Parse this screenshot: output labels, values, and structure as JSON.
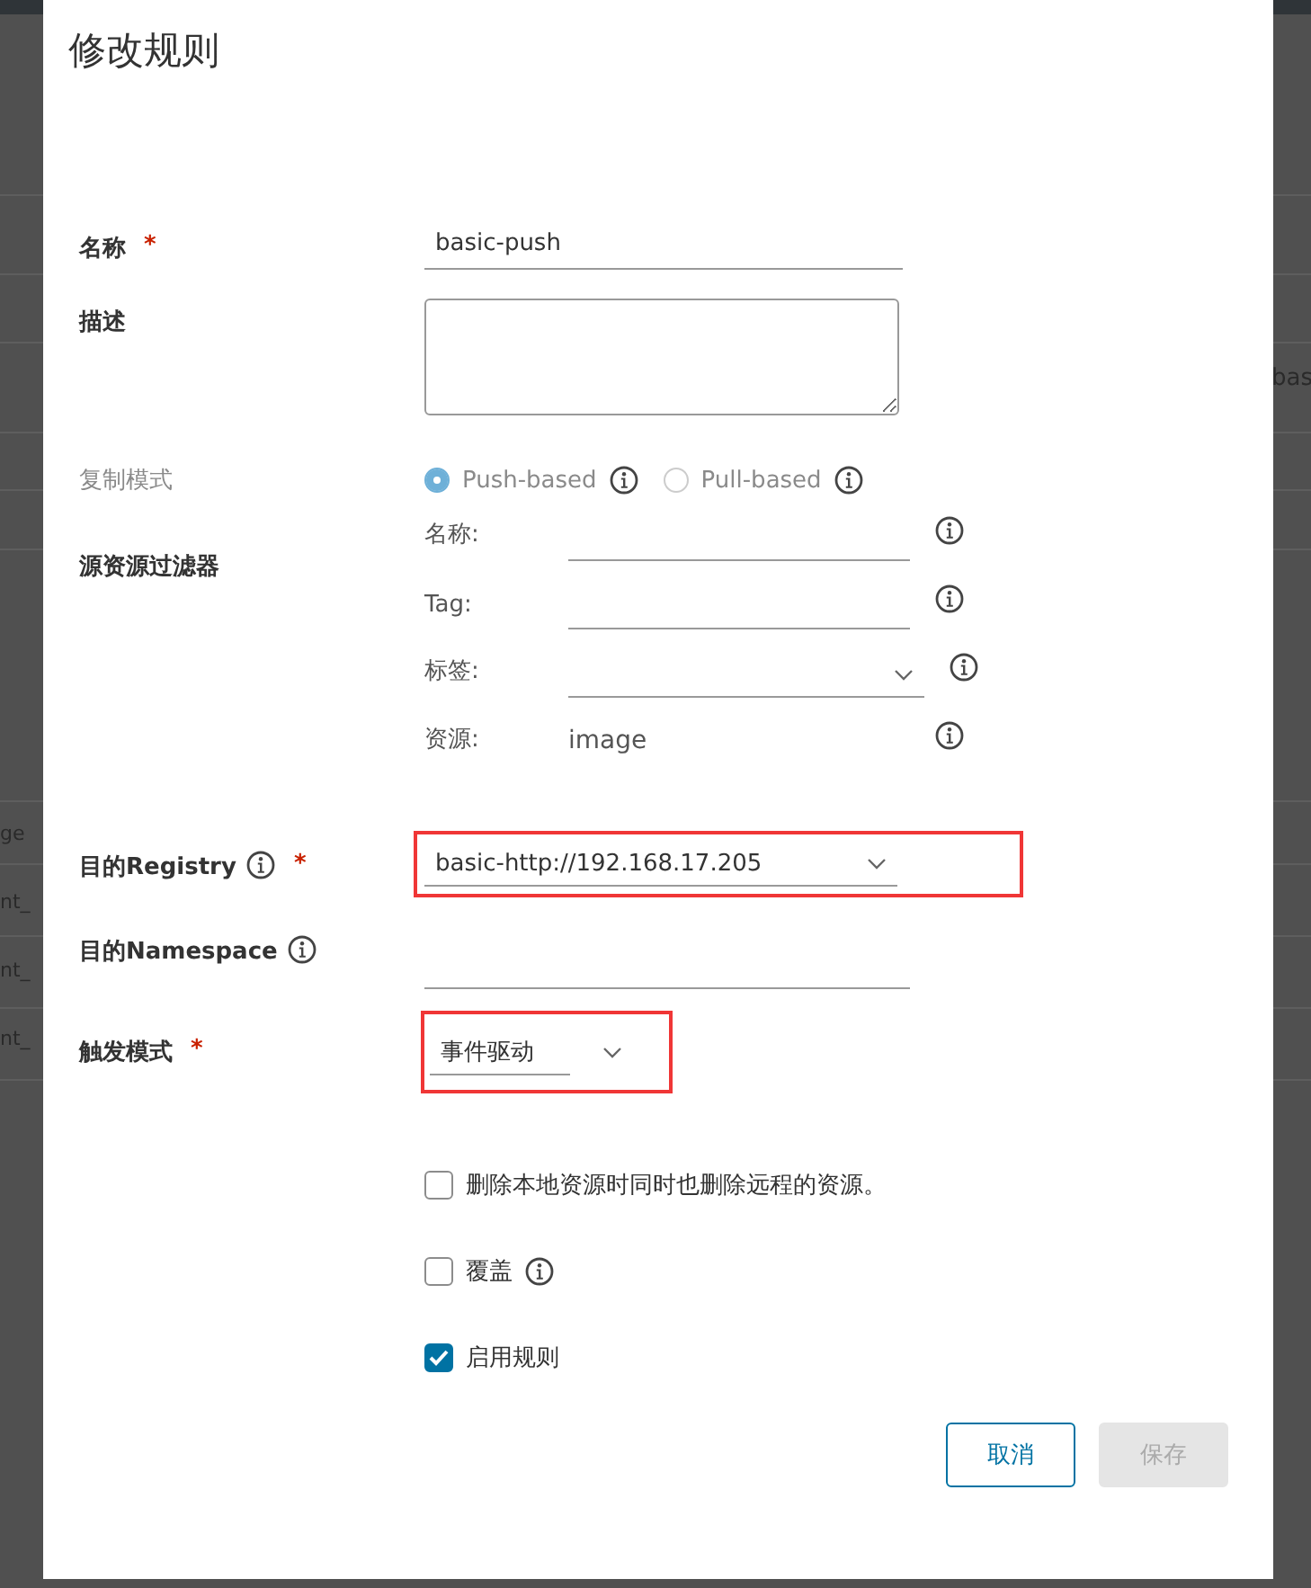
{
  "backdrop": {
    "left_fragments": [
      "ge",
      "nt_",
      "nt_",
      "nt_"
    ],
    "right_fragments": [
      "bas"
    ]
  },
  "dialog": {
    "title": "修改规则",
    "name": {
      "label": "名称",
      "required_mark": "*",
      "value": "basic-push"
    },
    "description": {
      "label": "描述"
    },
    "replication_mode": {
      "label": "复制模式",
      "disabled": true,
      "options": [
        {
          "label": "Push-based",
          "selected": true
        },
        {
          "label": "Pull-based",
          "selected": false
        }
      ]
    },
    "source_filter": {
      "label": "源资源过滤器",
      "filters": [
        {
          "kind": "input",
          "label": "名称:"
        },
        {
          "kind": "input",
          "label": "Tag:"
        },
        {
          "kind": "select",
          "label": "标签:"
        },
        {
          "kind": "text",
          "label": "资源:",
          "value": "image"
        }
      ]
    },
    "destination_registry": {
      "label": "目的Registry",
      "required_mark": "*",
      "value": "basic-http://192.168.17.205",
      "highlighted": true
    },
    "destination_namespace": {
      "label": "目的Namespace"
    },
    "trigger_mode": {
      "label": "触发模式",
      "required_mark": "*",
      "value": "事件驱动",
      "highlighted": true
    },
    "checkboxes": [
      {
        "label": "删除本地资源时同时也删除远程的资源。",
        "checked": false,
        "info": false
      },
      {
        "label": "覆盖",
        "checked": false,
        "info": true
      },
      {
        "label": "启用规则",
        "checked": true,
        "info": false
      }
    ],
    "buttons": [
      {
        "label": "取消",
        "kind": "secondary",
        "disabled": false
      },
      {
        "label": "保存",
        "kind": "primary",
        "disabled": true
      }
    ]
  }
}
